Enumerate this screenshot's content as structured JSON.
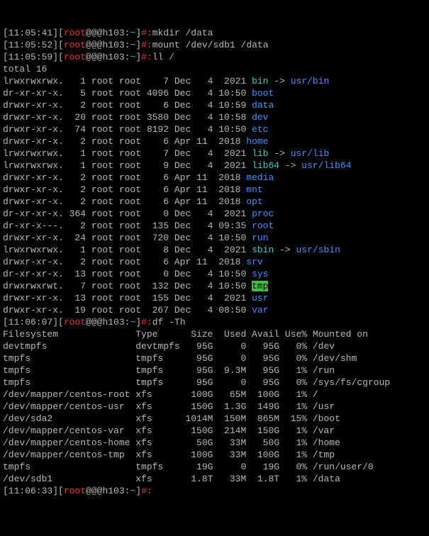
{
  "prompts": [
    {
      "time": "11:05:41",
      "user": "root",
      "host": "@@@h103",
      "path": "~",
      "sym": "#:",
      "cmd": "mkdir /data"
    },
    {
      "time": "11:05:52",
      "user": "root",
      "host": "@@@h103",
      "path": "~",
      "sym": "#:",
      "cmd": "mount /dev/sdb1 /data"
    },
    {
      "time": "11:05:59",
      "user": "root",
      "host": "@@@h103",
      "path": "~",
      "sym": "#:",
      "cmd": "ll /"
    },
    {
      "time": "11:06:07",
      "user": "root",
      "host": "@@@h103",
      "path": "~",
      "sym": "#:",
      "cmd": "df -Th"
    },
    {
      "time": "11:06:33",
      "user": "root",
      "host": "@@@h103",
      "path": "~",
      "sym": "#:",
      "cmd": ""
    }
  ],
  "total": "total 16",
  "ls": [
    {
      "perm": "lrwxrwxrwx.",
      "ln": "  1",
      "own": "root root",
      "sz": "   7",
      "date": "Dec   4  2021",
      "name": "bin",
      "style": "cyan",
      "arrow": " -> ",
      "target": "usr/bin",
      "tstyle": "blue"
    },
    {
      "perm": "dr-xr-xr-x.",
      "ln": "  5",
      "own": "root root",
      "sz": "4096",
      "date": "Dec   4 10:50",
      "name": "boot",
      "style": "blue"
    },
    {
      "perm": "drwxr-xr-x.",
      "ln": "  2",
      "own": "root root",
      "sz": "   6",
      "date": "Dec   4 10:59",
      "name": "data",
      "style": "blue"
    },
    {
      "perm": "drwxr-xr-x.",
      "ln": " 20",
      "own": "root root",
      "sz": "3580",
      "date": "Dec   4 10:58",
      "name": "dev",
      "style": "blue"
    },
    {
      "perm": "drwxr-xr-x.",
      "ln": " 74",
      "own": "root root",
      "sz": "8192",
      "date": "Dec   4 10:50",
      "name": "etc",
      "style": "blue"
    },
    {
      "perm": "drwxr-xr-x.",
      "ln": "  2",
      "own": "root root",
      "sz": "   6",
      "date": "Apr 11  2018",
      "name": "home",
      "style": "blue"
    },
    {
      "perm": "lrwxrwxrwx.",
      "ln": "  1",
      "own": "root root",
      "sz": "   7",
      "date": "Dec   4  2021",
      "name": "lib",
      "style": "cyan",
      "arrow": " -> ",
      "target": "usr/lib",
      "tstyle": "blue"
    },
    {
      "perm": "lrwxrwxrwx.",
      "ln": "  1",
      "own": "root root",
      "sz": "   9",
      "date": "Dec   4  2021",
      "name": "lib64",
      "style": "cyan",
      "arrow": " -> ",
      "target": "usr/lib64",
      "tstyle": "blue"
    },
    {
      "perm": "drwxr-xr-x.",
      "ln": "  2",
      "own": "root root",
      "sz": "   6",
      "date": "Apr 11  2018",
      "name": "media",
      "style": "blue"
    },
    {
      "perm": "drwxr-xr-x.",
      "ln": "  2",
      "own": "root root",
      "sz": "   6",
      "date": "Apr 11  2018",
      "name": "mnt",
      "style": "blue"
    },
    {
      "perm": "drwxr-xr-x.",
      "ln": "  2",
      "own": "root root",
      "sz": "   6",
      "date": "Apr 11  2018",
      "name": "opt",
      "style": "blue"
    },
    {
      "perm": "dr-xr-xr-x.",
      "ln": "364",
      "own": "root root",
      "sz": "   0",
      "date": "Dec   4  2021",
      "name": "proc",
      "style": "blue"
    },
    {
      "perm": "dr-xr-x---.",
      "ln": "  2",
      "own": "root root",
      "sz": " 135",
      "date": "Dec   4 09:35",
      "name": "root",
      "style": "blue"
    },
    {
      "perm": "drwxr-xr-x.",
      "ln": " 24",
      "own": "root root",
      "sz": " 720",
      "date": "Dec   4 10:50",
      "name": "run",
      "style": "blue"
    },
    {
      "perm": "lrwxrwxrwx.",
      "ln": "  1",
      "own": "root root",
      "sz": "   8",
      "date": "Dec   4  2021",
      "name": "sbin",
      "style": "cyan",
      "arrow": " -> ",
      "target": "usr/sbin",
      "tstyle": "blue"
    },
    {
      "perm": "drwxr-xr-x.",
      "ln": "  2",
      "own": "root root",
      "sz": "   6",
      "date": "Apr 11  2018",
      "name": "srv",
      "style": "blue"
    },
    {
      "perm": "dr-xr-xr-x.",
      "ln": " 13",
      "own": "root root",
      "sz": "   0",
      "date": "Dec   4 10:50",
      "name": "sys",
      "style": "blue"
    },
    {
      "perm": "drwxrwxrwt.",
      "ln": "  7",
      "own": "root root",
      "sz": " 132",
      "date": "Dec   4 10:50",
      "name": "tmp",
      "style": "tmp"
    },
    {
      "perm": "drwxr-xr-x.",
      "ln": " 13",
      "own": "root root",
      "sz": " 155",
      "date": "Dec   4  2021",
      "name": "usr",
      "style": "blue"
    },
    {
      "perm": "drwxr-xr-x.",
      "ln": " 19",
      "own": "root root",
      "sz": " 267",
      "date": "Dec   4 08:50",
      "name": "var",
      "style": "blue"
    }
  ],
  "dfhead": "Filesystem              Type      Size  Used Avail Use% Mounted on",
  "df": [
    "devtmpfs                devtmpfs   95G     0   95G   0% /dev",
    "tmpfs                   tmpfs      95G     0   95G   0% /dev/shm",
    "tmpfs                   tmpfs      95G  9.3M   95G   1% /run",
    "tmpfs                   tmpfs      95G     0   95G   0% /sys/fs/cgroup",
    "/dev/mapper/centos-root xfs       100G   65M  100G   1% /",
    "/dev/mapper/centos-usr  xfs       150G  1.3G  149G   1% /usr",
    "/dev/sda2               xfs      1014M  150M  865M  15% /boot",
    "/dev/mapper/centos-var  xfs       150G  214M  150G   1% /var",
    "/dev/mapper/centos-home xfs        50G   33M   50G   1% /home",
    "/dev/mapper/centos-tmp  xfs       100G   33M  100G   1% /tmp",
    "tmpfs                   tmpfs      19G     0   19G   0% /run/user/0",
    "/dev/sdb1               xfs       1.8T   33M  1.8T   1% /data"
  ]
}
